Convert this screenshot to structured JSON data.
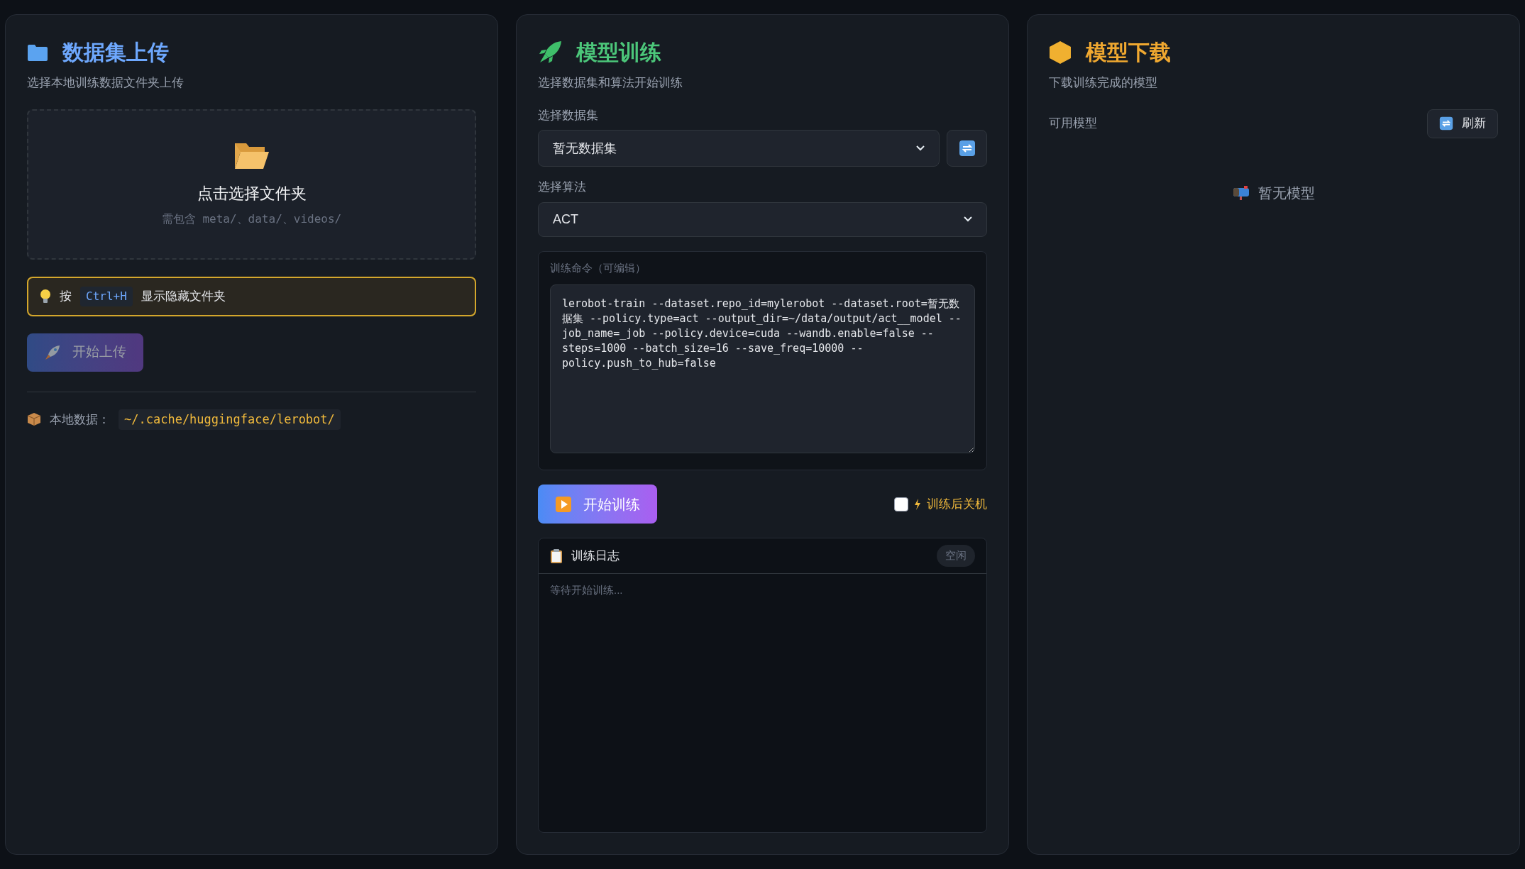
{
  "upload_panel": {
    "title": "数据集上传",
    "subtitle": "选择本地训练数据文件夹上传",
    "drop_zone": {
      "title": "点击选择文件夹",
      "hint": "需包含 meta/、data/、videos/"
    },
    "tip": {
      "prefix": "按",
      "key": "Ctrl+H",
      "suffix": "显示隐藏文件夹"
    },
    "upload_button": {
      "label": "开始上传",
      "disabled": true
    },
    "local_data": {
      "label": "本地数据：",
      "path": "~/.cache/huggingface/lerobot/"
    }
  },
  "training_panel": {
    "title": "模型训练",
    "subtitle": "选择数据集和算法开始训练",
    "dataset_label": "选择数据集",
    "dataset_value": "暂无数据集",
    "algorithm_label": "选择算法",
    "algorithm_value": "ACT",
    "command_label": "训练命令（可编辑）",
    "command": "lerobot-train --dataset.repo_id=mylerobot --dataset.root=暂无数据集 --policy.type=act --output_dir=~/data/output/act__model --job_name=_job --policy.device=cuda --wandb.enable=false --steps=1000 --batch_size=16 --save_freq=10000 --policy.push_to_hub=false",
    "start_button": "开始训练",
    "shutdown_option": {
      "label": "训练后关机",
      "checked": false
    },
    "log": {
      "title": "训练日志",
      "status": "空闲",
      "text": "等待开始训练..."
    }
  },
  "download_panel": {
    "title": "模型下载",
    "subtitle": "下载训练完成的模型",
    "list_label": "可用模型",
    "refresh_button": "刷新",
    "empty_text": "暂无模型"
  }
}
